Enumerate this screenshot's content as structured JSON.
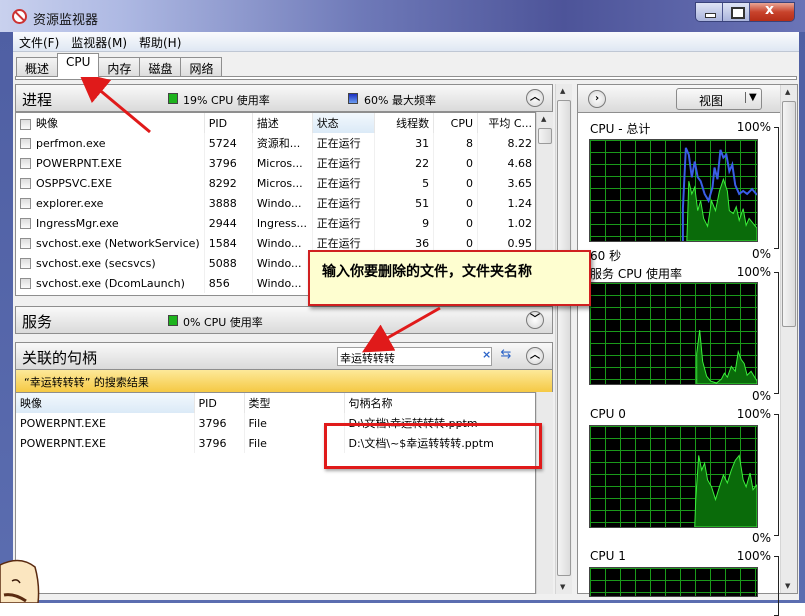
{
  "window": {
    "title": "资源监视器",
    "icon": "resource-monitor-icon",
    "buttons": [
      "minimize",
      "maximize",
      "close"
    ]
  },
  "menu": [
    "文件(F)",
    "监视器(M)",
    "帮助(H)"
  ],
  "tabs": [
    {
      "label": "概述",
      "active": false
    },
    {
      "label": "CPU",
      "active": true
    },
    {
      "label": "内存",
      "active": false
    },
    {
      "label": "磁盘",
      "active": false
    },
    {
      "label": "网络",
      "active": false
    }
  ],
  "processes": {
    "title": "进程",
    "cpu_usage": "19% CPU 使用率",
    "max_freq": "60% 最大频率",
    "colors": {
      "cpu": "#1db31d",
      "freq": "#2e4fd6"
    },
    "columns": [
      "映像",
      "PID",
      "描述",
      "状态",
      "线程数",
      "CPU",
      "平均 C..."
    ],
    "rows": [
      {
        "image": "perfmon.exe",
        "pid": "5724",
        "desc": "资源和...",
        "status": "正在运行",
        "threads": "31",
        "cpu": "8",
        "avg": "8.22"
      },
      {
        "image": "POWERPNT.EXE",
        "pid": "3796",
        "desc": "Micros...",
        "status": "正在运行",
        "threads": "22",
        "cpu": "0",
        "avg": "4.68"
      },
      {
        "image": "OSPPSVC.EXE",
        "pid": "8292",
        "desc": "Micros...",
        "status": "正在运行",
        "threads": "5",
        "cpu": "0",
        "avg": "3.65"
      },
      {
        "image": "explorer.exe",
        "pid": "3888",
        "desc": "Windo...",
        "status": "正在运行",
        "threads": "51",
        "cpu": "0",
        "avg": "1.24"
      },
      {
        "image": "IngressMgr.exe",
        "pid": "2944",
        "desc": "Ingress...",
        "status": "正在运行",
        "threads": "9",
        "cpu": "0",
        "avg": "1.02"
      },
      {
        "image": "svchost.exe (NetworkService)",
        "pid": "1584",
        "desc": "Windo...",
        "status": "正在运行",
        "threads": "36",
        "cpu": "0",
        "avg": "0.95"
      },
      {
        "image": "svchost.exe (secsvcs)",
        "pid": "5088",
        "desc": "Windo...",
        "status": "",
        "threads": "",
        "cpu": "",
        "avg": ""
      },
      {
        "image": "svchost.exe (DcomLaunch)",
        "pid": "856",
        "desc": "Windo...",
        "status": "",
        "threads": "",
        "cpu": "",
        "avg": ""
      }
    ]
  },
  "services": {
    "title": "服务",
    "cpu_usage": "0% CPU 使用率"
  },
  "handles": {
    "title": "关联的句柄",
    "search_value": "幸运转转转",
    "results_label": "“幸运转转转” 的搜索结果",
    "columns": [
      "映像",
      "PID",
      "类型",
      "句柄名称"
    ],
    "rows": [
      {
        "image": "POWERPNT.EXE",
        "pid": "3796",
        "type": "File",
        "name": "D:\\文档\\幸运转转转.pptm"
      },
      {
        "image": "POWERPNT.EXE",
        "pid": "3796",
        "type": "File",
        "name": "D:\\文档\\~$幸运转转转.pptm"
      }
    ]
  },
  "right_panel": {
    "view_label": "视图",
    "graphs": [
      {
        "title": "CPU - 总计",
        "max": "100%",
        "min": "0%",
        "time": "60 秒"
      },
      {
        "title": "服务 CPU 使用率",
        "max": "100%",
        "min": "0%"
      },
      {
        "title": "CPU 0",
        "max": "100%",
        "min": "0%"
      },
      {
        "title": "CPU 1",
        "max": "100%"
      }
    ]
  },
  "annotation": {
    "callout": "输入你要删除的文件，文件夹名称"
  }
}
